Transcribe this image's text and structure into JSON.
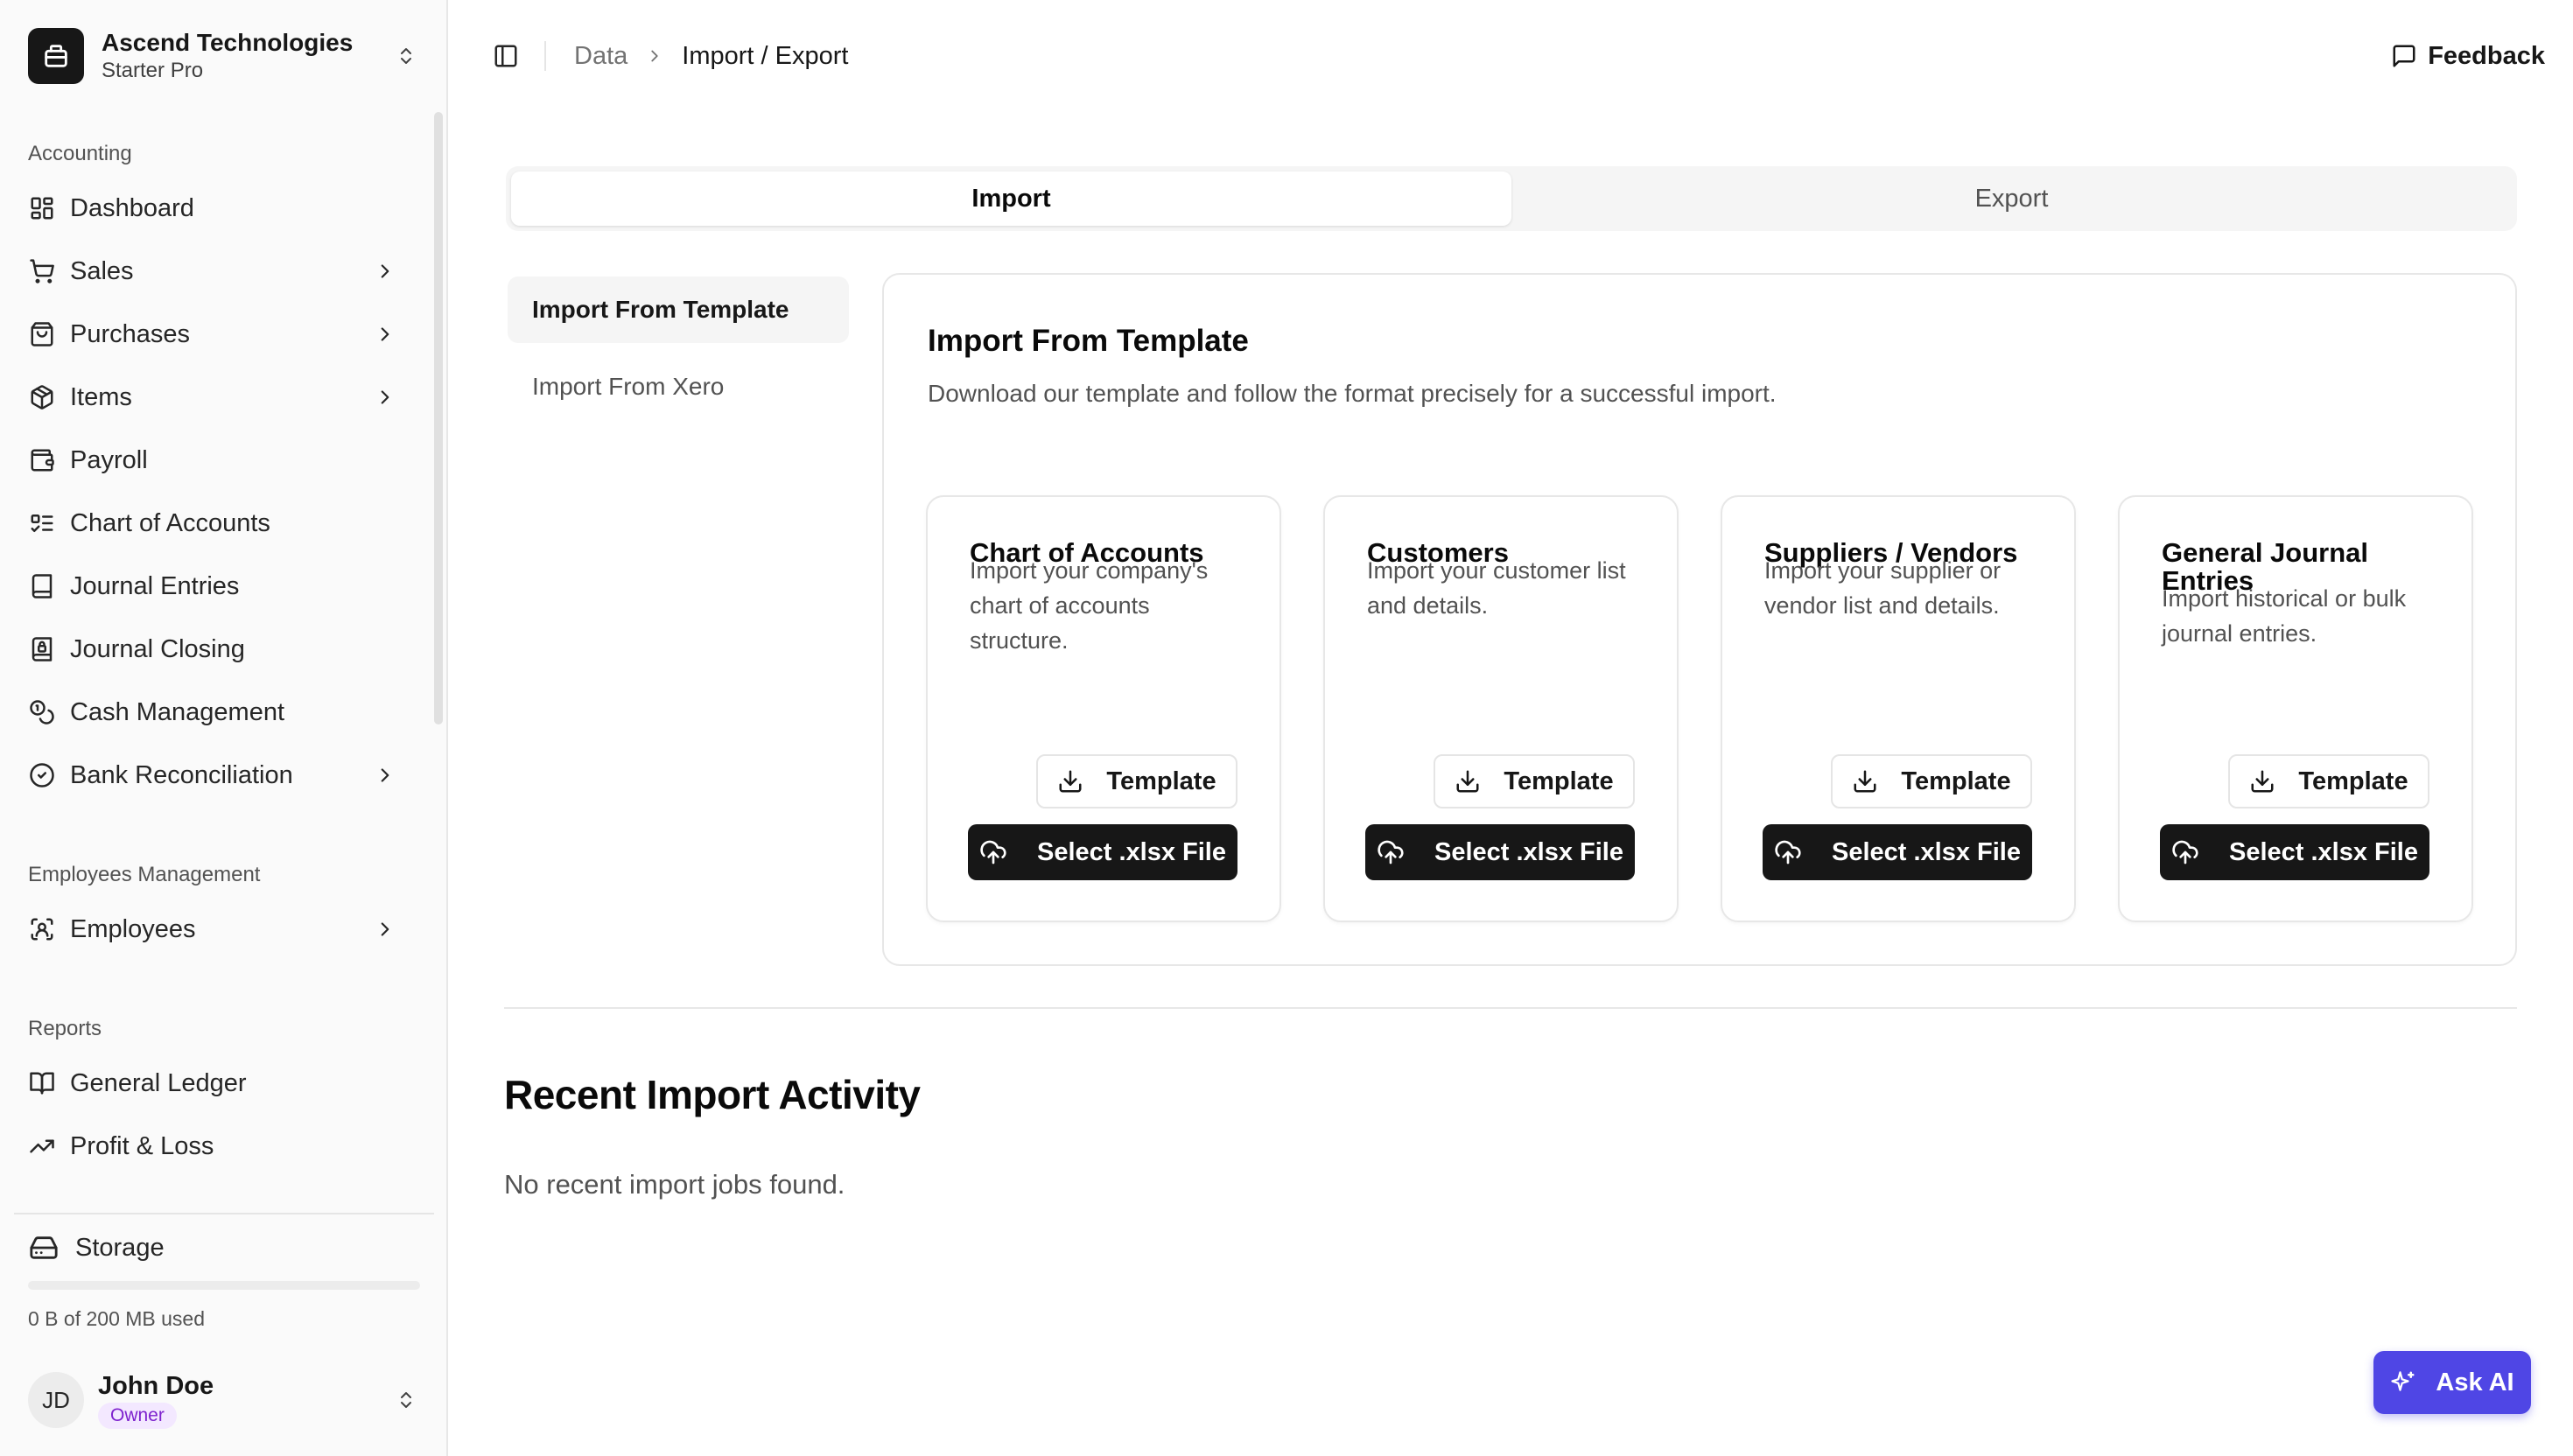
{
  "org": {
    "name": "Ascend Technologies",
    "plan": "Starter Pro"
  },
  "sidebar": {
    "accounting_label": "Accounting",
    "accounting_items": [
      {
        "label": "Dashboard",
        "icon": "dashboard-icon",
        "has_children": false
      },
      {
        "label": "Sales",
        "icon": "cart-icon",
        "has_children": true
      },
      {
        "label": "Purchases",
        "icon": "shopping-bag-icon",
        "has_children": true
      },
      {
        "label": "Items",
        "icon": "package-icon",
        "has_children": true
      },
      {
        "label": "Payroll",
        "icon": "wallet-icon",
        "has_children": false
      },
      {
        "label": "Chart of Accounts",
        "icon": "list-icon",
        "has_children": false
      },
      {
        "label": "Journal Entries",
        "icon": "book-icon",
        "has_children": false
      },
      {
        "label": "Journal Closing",
        "icon": "book-lock-icon",
        "has_children": false
      },
      {
        "label": "Cash Management",
        "icon": "coins-icon",
        "has_children": false
      },
      {
        "label": "Bank Reconciliation",
        "icon": "check-circle-icon",
        "has_children": true
      }
    ],
    "employees_label": "Employees Management",
    "employees_items": [
      {
        "label": "Employees",
        "icon": "user-scan-icon",
        "has_children": true
      }
    ],
    "reports_label": "Reports",
    "reports_items": [
      {
        "label": "General Ledger",
        "icon": "ledger-icon",
        "has_children": false
      },
      {
        "label": "Profit & Loss",
        "icon": "trending-up-icon",
        "has_children": false
      }
    ]
  },
  "storage": {
    "label": "Storage",
    "used_text": "0 B of 200 MB used",
    "used_fraction": 0
  },
  "user": {
    "initials": "JD",
    "name": "John Doe",
    "role": "Owner"
  },
  "header": {
    "breadcrumb_parent": "Data",
    "breadcrumb_current": "Import / Export",
    "feedback_label": "Feedback"
  },
  "tabs": {
    "import": "Import",
    "export": "Export",
    "active": "import"
  },
  "subnav": {
    "template": "Import From Template",
    "xero": "Import From Xero"
  },
  "panel": {
    "title": "Import From Template",
    "description": "Download our template and follow the format precisely for a successful import."
  },
  "cards": [
    {
      "title": "Chart of Accounts",
      "description": "Import your company's chart of accounts structure.",
      "template_label": "Template",
      "select_label": "Select .xlsx File"
    },
    {
      "title": "Customers",
      "description": "Import your customer list and details.",
      "template_label": "Template",
      "select_label": "Select .xlsx File"
    },
    {
      "title": "Suppliers / Vendors",
      "description": "Import your supplier or vendor list and details.",
      "template_label": "Template",
      "select_label": "Select .xlsx File"
    },
    {
      "title": "General Journal Entries",
      "description": "Import historical or bulk journal entries.",
      "template_label": "Template",
      "select_label": "Select .xlsx File"
    }
  ],
  "recent": {
    "title": "Recent Import Activity",
    "empty": "No recent import jobs found."
  },
  "ask_ai": {
    "label": "Ask AI"
  },
  "colors": {
    "primary": "#171717",
    "accent": "#4f46e5",
    "badge_bg": "#f3e8ff",
    "badge_text": "#7e22ce"
  }
}
